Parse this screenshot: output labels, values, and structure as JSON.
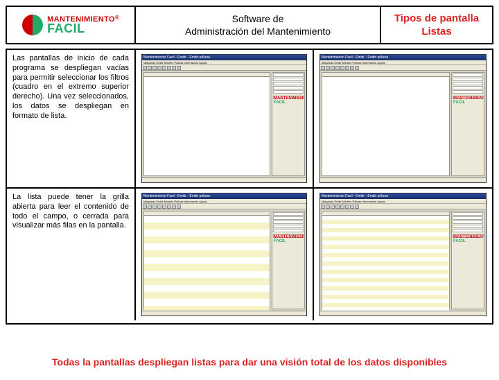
{
  "brand": {
    "line1": "MANTENIMIENTO",
    "line2": "FACIL",
    "reg": "®"
  },
  "header": {
    "center_line1": "Software de",
    "center_line2": "Administración del Mantenimiento",
    "right_line1": "Tipos de pantalla",
    "right_line2": "Listas"
  },
  "paragraphs": {
    "p1": "Las pantallas de inicio de cada programa se despliegan vacías para permitir seleccionar los filtros (cuadro en el extremo superior derecho). Una vez seleccionados, los datos se despliegan en formato de lista.",
    "p2": "La lista puede tener la grilla abierta para leer el contenido de todo el campo, o cerrada para visualizar más filas en la pantalla."
  },
  "app_window": {
    "title": "Mantenimiento Facil - Emitir - Emitir pólizas",
    "menu": "Máquinas  Emitir  Móviles  Pólizas  Información  Ayuda"
  },
  "footer": "Todas la pantallas despliegan listas para dar una visión total de los datos disponibles"
}
